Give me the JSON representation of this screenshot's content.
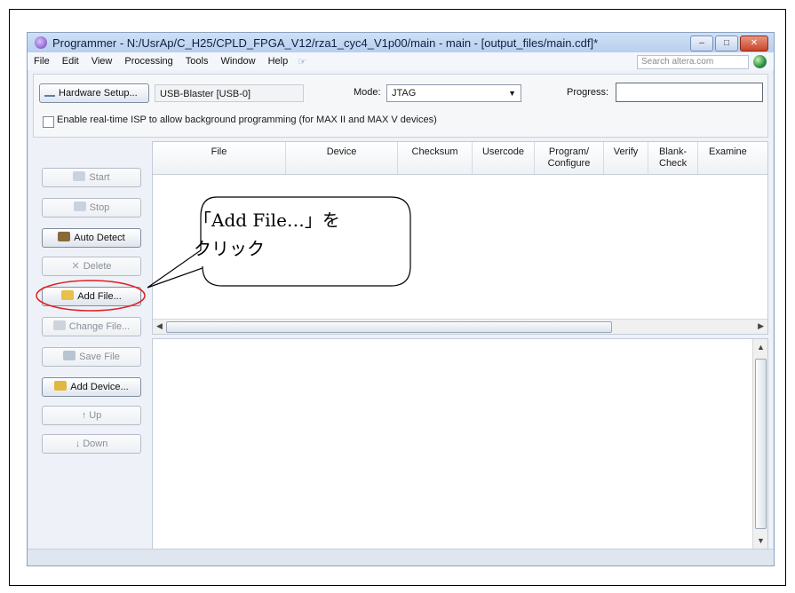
{
  "window": {
    "title": "Programmer - N:/UsrAp/C_H25/CPLD_FPGA_V12/rza1_cyc4_V1p00/main - main - [output_files/main.cdf]*"
  },
  "menu": {
    "items": [
      "File",
      "Edit",
      "View",
      "Processing",
      "Tools",
      "Window",
      "Help"
    ],
    "search_placeholder": "Search altera.com"
  },
  "toolbar": {
    "hardware_setup_label": "Hardware Setup...",
    "hardware_value": "USB-Blaster [USB-0]",
    "mode_label": "Mode:",
    "mode_value": "JTAG",
    "progress_label": "Progress:",
    "isp_checkbox_label": "Enable real-time ISP to allow background programming (for MAX II and MAX V devices)",
    "isp_checked": false
  },
  "sidebar": {
    "start": "Start",
    "stop": "Stop",
    "auto_detect": "Auto Detect",
    "delete": "Delete",
    "add_file": "Add File...",
    "change_file": "Change File...",
    "save_file": "Save File",
    "add_device": "Add Device...",
    "up": "Up",
    "down": "Down"
  },
  "table": {
    "columns": [
      "File",
      "Device",
      "Checksum",
      "Usercode",
      "Program/ Configure",
      "Verify",
      "Blank- Check",
      "Examine"
    ],
    "rows": []
  },
  "callout": {
    "line1": "「Add File…」を",
    "line2": "クリック",
    "highlight_color": "#e02020"
  },
  "icons": {
    "app": "programmer-icon",
    "globe": "globe-icon"
  }
}
